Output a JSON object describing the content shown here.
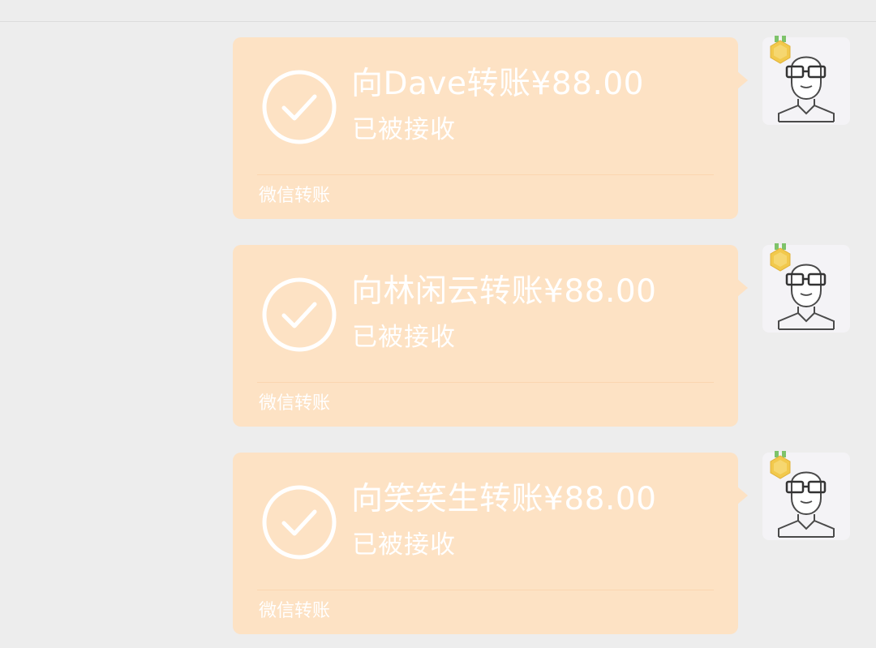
{
  "theme": {
    "page_background": "#ededed",
    "bubble_color": "#fde2c4",
    "text_color": "#ffffff",
    "medal_color": "#f2c94c"
  },
  "messages": [
    {
      "title": "向Dave转账¥88.00",
      "status": "已被接收",
      "footer": "微信转账",
      "status_icon": "check-circle-icon",
      "avatar_icon": "bald-man-with-glasses-avatar",
      "badge_icon": "medal-icon"
    },
    {
      "title": "向林闲云转账¥88.00",
      "status": "已被接收",
      "footer": "微信转账",
      "status_icon": "check-circle-icon",
      "avatar_icon": "bald-man-with-glasses-avatar",
      "badge_icon": "medal-icon"
    },
    {
      "title": "向笑笑生转账¥88.00",
      "status": "已被接收",
      "footer": "微信转账",
      "status_icon": "check-circle-icon",
      "avatar_icon": "bald-man-with-glasses-avatar",
      "badge_icon": "medal-icon"
    }
  ]
}
